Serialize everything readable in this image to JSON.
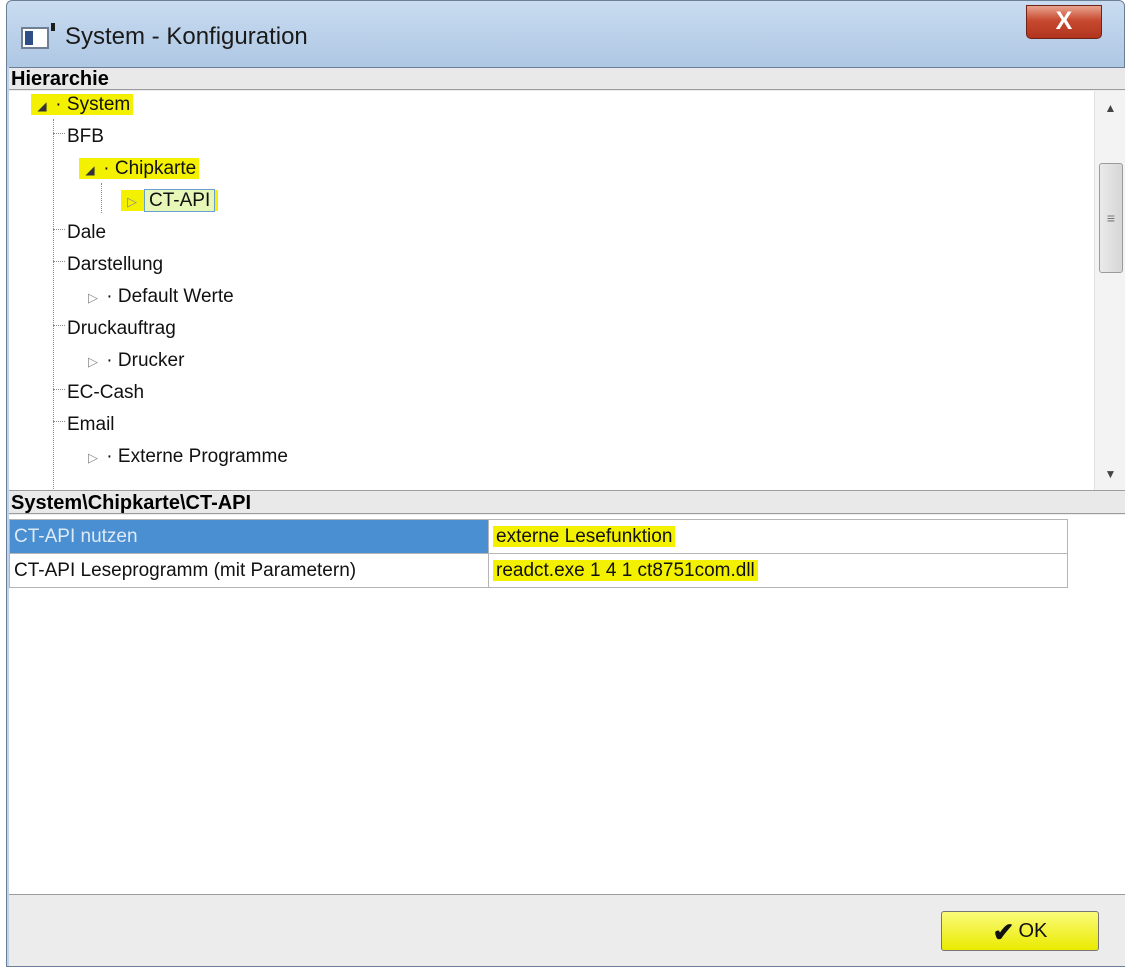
{
  "window": {
    "title": "System - Konfiguration",
    "close_glyph": "X"
  },
  "hierarchy": {
    "header": "Hierarchie",
    "nodes": [
      {
        "label": "System",
        "expander": "◢",
        "state": "expanded",
        "highlighted": true
      },
      {
        "label": "BFB",
        "expander": "",
        "state": "leaf"
      },
      {
        "label": "Chipkarte",
        "expander": "◢",
        "state": "expanded",
        "highlighted": true
      },
      {
        "label": "CT-API",
        "expander": "▷",
        "state": "collapsed",
        "selected": true
      },
      {
        "label": "Dale",
        "expander": "",
        "state": "leaf"
      },
      {
        "label": "Darstellung",
        "expander": "",
        "state": "leaf"
      },
      {
        "label": "Default Werte",
        "expander": "▷",
        "state": "collapsed"
      },
      {
        "label": "Druckauftrag",
        "expander": "",
        "state": "leaf"
      },
      {
        "label": "Drucker",
        "expander": "▷",
        "state": "collapsed"
      },
      {
        "label": "EC-Cash",
        "expander": "",
        "state": "leaf"
      },
      {
        "label": "Email",
        "expander": "",
        "state": "leaf"
      },
      {
        "label": "Externe Programme",
        "expander": "▷",
        "state": "collapsed"
      }
    ]
  },
  "scrollbar": {
    "up_glyph": "▲",
    "down_glyph": "▼",
    "grip_glyph": "≡"
  },
  "properties": {
    "path": "System\\Chipkarte\\CT-API",
    "rows": [
      {
        "key": "CT-API nutzen",
        "value": "externe Lesefunktion"
      },
      {
        "key": "CT-API Leseprogramm (mit Parametern)",
        "value": "readct.exe 1 4 1 ct8751com.dll"
      }
    ]
  },
  "footer": {
    "ok_label": "OK",
    "ok_glyph": "✔"
  },
  "colors": {
    "highlight": "#f4f100",
    "selection": "#4a8fd1",
    "window_frame": "#bfd3ea"
  }
}
